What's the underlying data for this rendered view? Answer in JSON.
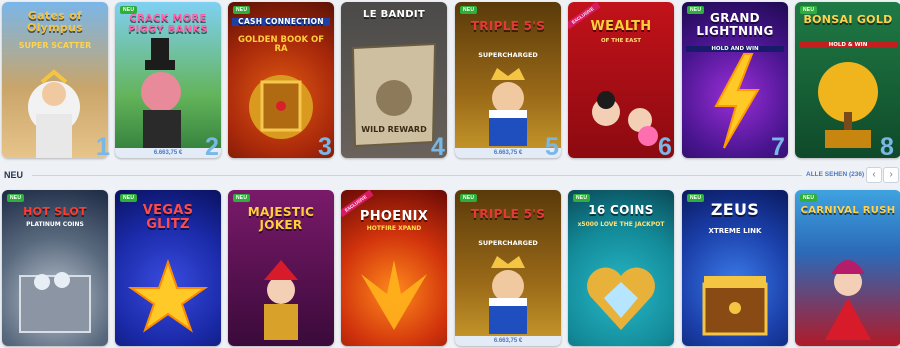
{
  "row1": {
    "games": [
      {
        "title": "Gates of Olympus",
        "subtitle": "SUPER SCATTER",
        "rank": "1",
        "badge": "",
        "jackpot": ""
      },
      {
        "title": "CRACK MORE PIGGY BANKS",
        "subtitle": "",
        "rank": "2",
        "badge": "NEU",
        "jackpot": "6.663,75 €"
      },
      {
        "title": "CASH CONNECTION",
        "subtitle": "GOLDEN BOOK OF RA",
        "rank": "3",
        "badge": "NEU",
        "jackpot": ""
      },
      {
        "title": "LE BANDIT",
        "subtitle": "WILD REWARD",
        "rank": "4",
        "badge": "",
        "jackpot": ""
      },
      {
        "title": "TRIPLE 5'S",
        "subtitle": "SUPERCHARGED",
        "rank": "5",
        "badge": "NEU",
        "jackpot": "6.663,75 €"
      },
      {
        "title": "WEALTH",
        "subtitle": "OF THE EAST",
        "rank": "6",
        "badge": "EXCLUSIVE",
        "jackpot": ""
      },
      {
        "title": "GRAND LIGHTNING",
        "subtitle": "HOLD AND WIN",
        "rank": "7",
        "badge": "NEU",
        "jackpot": ""
      },
      {
        "title": "BONSAI GOLD",
        "subtitle": "HOLD & WIN",
        "rank": "8",
        "badge": "NEU",
        "jackpot": ""
      }
    ]
  },
  "section": {
    "title": "NEU",
    "see_all": "ALLE SEHEN (236)",
    "prev_icon": "‹",
    "next_icon": "›"
  },
  "row2": {
    "games": [
      {
        "title": "HOT SLOT",
        "subtitle": "PLATINUM COINS",
        "badge": "NEU",
        "jackpot": ""
      },
      {
        "title": "VEGAS GLITZ",
        "subtitle": "",
        "badge": "NEU",
        "jackpot": ""
      },
      {
        "title": "MAJESTIC JOKER",
        "subtitle": "",
        "badge": "NEU",
        "jackpot": ""
      },
      {
        "title": "PHOENIX",
        "subtitle": "HOTFIRE XPAND",
        "badge": "EXCLUSIVE",
        "jackpot": ""
      },
      {
        "title": "TRIPLE 5'S",
        "subtitle": "SUPERCHARGED",
        "badge": "NEU",
        "jackpot": "6.663,75 €"
      },
      {
        "title": "16 COINS",
        "subtitle": "x5000 LOVE THE JACKPOT",
        "badge": "NEU",
        "jackpot": ""
      },
      {
        "title": "ZEUS",
        "subtitle": "XTREME LINK",
        "badge": "NEU",
        "jackpot": ""
      },
      {
        "title": "CARNIVAL RUSH",
        "subtitle": "",
        "badge": "NEU",
        "jackpot": ""
      }
    ]
  },
  "colors": {
    "rank": "#79b7e6",
    "link": "#4a78c2",
    "badge_new": "#2fae3b",
    "badge_exclusive": "#d81b60"
  }
}
